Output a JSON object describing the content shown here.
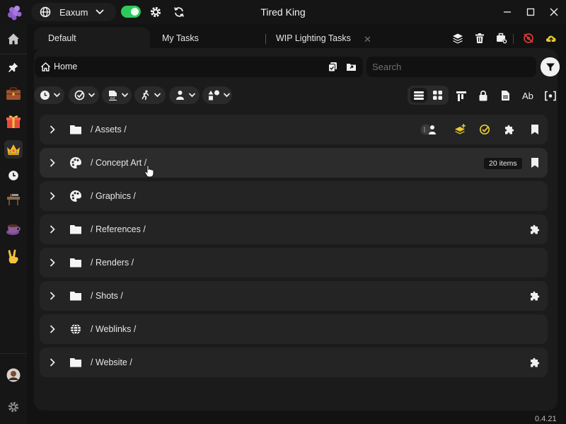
{
  "window": {
    "title": "Tired King"
  },
  "project": {
    "name": "Eaxum"
  },
  "tabs": [
    {
      "label": "Default"
    },
    {
      "label": "My Tasks"
    },
    {
      "label": "WIP Lighting Tasks"
    }
  ],
  "breadcrumb": {
    "home_label": "Home"
  },
  "search": {
    "placeholder": "Search",
    "value": ""
  },
  "view_options": {
    "text_format_label": "Ab"
  },
  "folders": [
    {
      "label": "/ Assets /",
      "icon": "folder-icon"
    },
    {
      "label": "/ Concept Art /",
      "icon": "palette-icon",
      "badge": "20 items"
    },
    {
      "label": "/ Graphics /",
      "icon": "palette-icon"
    },
    {
      "label": "/ References /",
      "icon": "folder-icon"
    },
    {
      "label": "/ Renders /",
      "icon": "folder-icon"
    },
    {
      "label": "/ Shots /",
      "icon": "folder-icon"
    },
    {
      "label": "/ Weblinks /",
      "icon": "globe-icon"
    },
    {
      "label": "/ Website /",
      "icon": "folder-icon"
    }
  ],
  "version": "0.4.21",
  "colors": {
    "toggle_on": "#2ec95c",
    "accent_yellow": "#e8c832",
    "danger_red": "#d83a3a",
    "background": "#121212",
    "panel": "#1b1b1b",
    "row": "#242424"
  }
}
